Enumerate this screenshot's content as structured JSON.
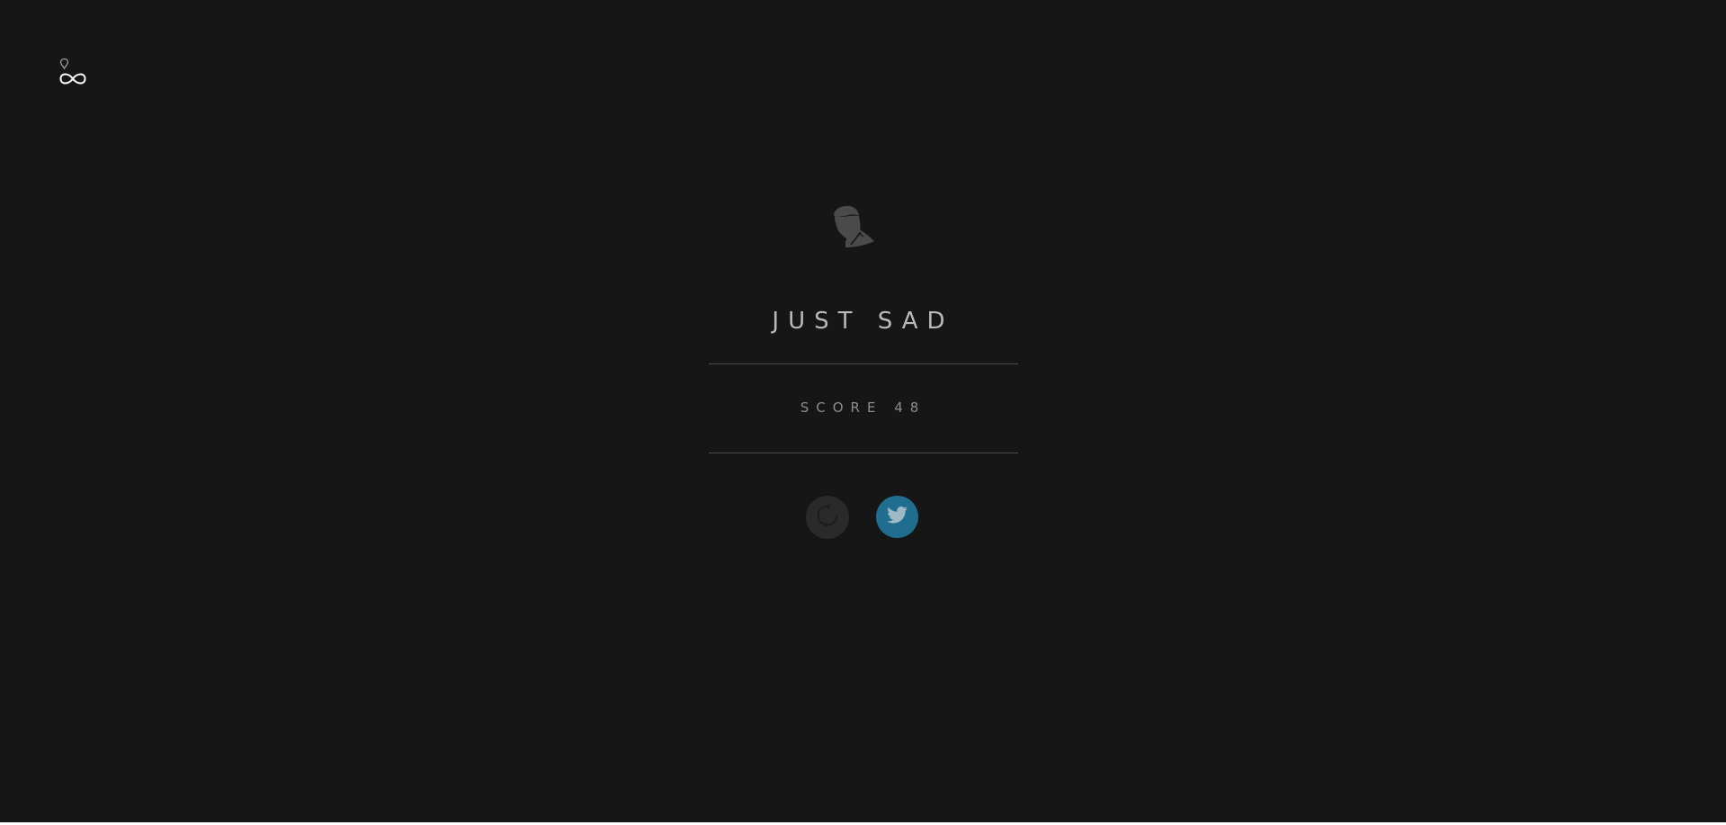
{
  "logo": {
    "icon": "infinity-balloon-icon"
  },
  "result": {
    "portrait_icon": "silhouette-portrait-icon",
    "title": "JUST SAD",
    "score_text": "SCORE 48"
  },
  "actions": {
    "replay_icon": "refresh-icon",
    "share_icon": "twitter-bird-icon"
  },
  "colors": {
    "background": "#161616",
    "title": "#b9b9b9",
    "score": "#8c8c8c",
    "divider": "#4a4a4a",
    "replay_button": "#2a2a2a",
    "twitter_button": "#1f6e8f"
  }
}
